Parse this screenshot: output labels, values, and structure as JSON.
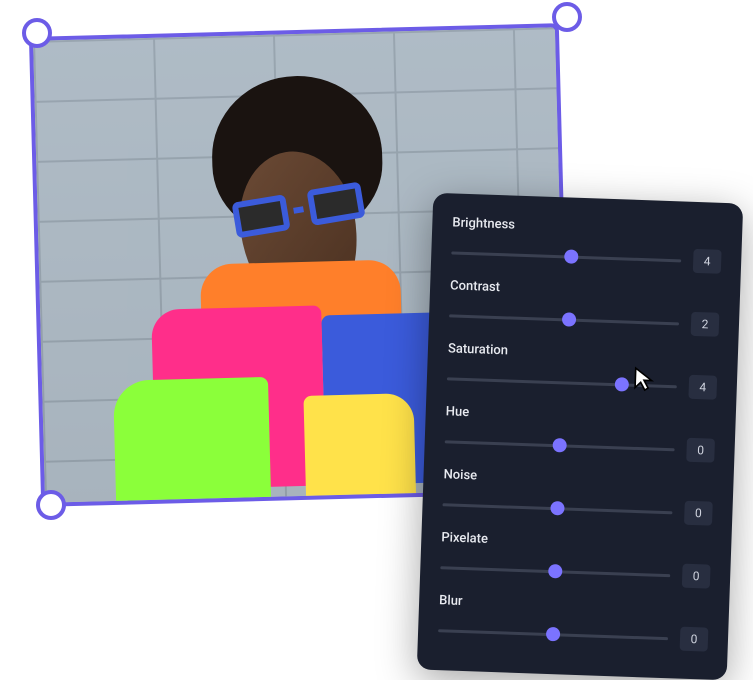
{
  "image_description": "Person wearing blue sunglasses and a multicolor (orange, pink, green, yellow, blue) jacket against a light brick wall",
  "selection": {
    "border_color": "#6c5ce7",
    "handle_color": "#ffffff"
  },
  "panel": {
    "bg": "#1a1f2e",
    "sliders": [
      {
        "label": "Brightness",
        "value": 4,
        "thumb_pct": 52
      },
      {
        "label": "Contrast",
        "value": 2,
        "thumb_pct": 52
      },
      {
        "label": "Saturation",
        "value": 4,
        "thumb_pct": 76
      },
      {
        "label": "Hue",
        "value": 0,
        "thumb_pct": 50
      },
      {
        "label": "Noise",
        "value": 0,
        "thumb_pct": 50
      },
      {
        "label": "Pixelate",
        "value": 0,
        "thumb_pct": 50
      },
      {
        "label": "Blur",
        "value": 0,
        "thumb_pct": 50
      }
    ]
  },
  "cursor": {
    "active_slider": "Saturation"
  }
}
